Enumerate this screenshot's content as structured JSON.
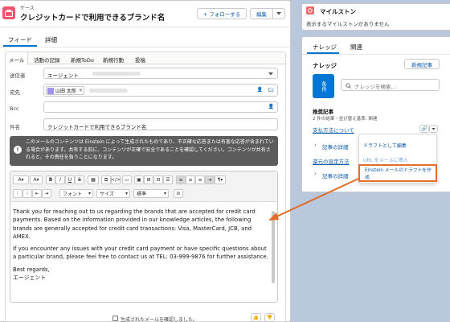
{
  "header": {
    "object_label": "ケース",
    "title": "クレジットカードで利用できるブランド名",
    "follow_label": "+ フォローする",
    "edit_label": "編集"
  },
  "tabs": {
    "feed": "フィード",
    "detail": "詳細"
  },
  "composer_tabs": [
    "メール",
    "活動の記録",
    "新規ToDo",
    "新規行動",
    "投稿"
  ],
  "email": {
    "from_label": "送信者",
    "from_value": "エージェント",
    "to_label": "宛先",
    "to_chip": "山田 太郎",
    "cc_label": "Cc",
    "bcc_label": "Bcc",
    "subject_label": "件名",
    "subject_value": "クレジットカードで利用できるブランド名",
    "notice": "このメールのコンテンツは Einstein によって生成されたものであり、不正確な応答または有害な応答が含まれている場合があります。共有する前に、コンテンツが正確で安全であることを確認してください。コンテンツが共有されると、その責任を負うことになります。",
    "font_select": "フォント",
    "size_select": "サイズ",
    "style_select": "標準",
    "body": [
      "Thank you for reaching out to us regarding the brands that are accepted for credit card payments. Based on the information provided in our knowledge articles, the following brands are generally accepted for credit card transactions: Visa, MasterCard, JCB, and AMEX.",
      "If you encounter any issues with your credit card payment or have specific questions about a particular brand, please feel free to contact us at TEL: 03-999-9876 for further assistance.",
      "Best regards,",
      "エージェント"
    ],
    "verify_label": "生成されたメールを確認しました。"
  },
  "milestone": {
    "title": "マイルストン",
    "empty_text": "表示するマイルストンがありません"
  },
  "knowledge": {
    "tab_knowledge": "ナレッジ",
    "tab_related": "関連",
    "section_title": "ナレッジ",
    "new_article": "新規記事",
    "filter_button": "条件",
    "search_placeholder": "ナレッジを検索...",
    "recommended_title": "推奨記事",
    "recommended_sub": "2 件の結果・並び替え基準: 関連",
    "article1_link": "支払方法について",
    "article1_detail": "記事の詳細",
    "article2_link": "還元の設定方法",
    "article2_detail": "記事の詳細",
    "menu_edit_draft": "ドラフトとして編集",
    "menu_insert_url": "URL をメールに挿入",
    "menu_einstein_draft": "Einstein メールのドラフトを作成"
  },
  "colors": {
    "brand_blue": "#0176d3",
    "highlight_orange": "#e36d2a",
    "case_pink": "#f2536d",
    "milestone_orange": "#e9696e",
    "notice_gray": "#5c5c5c"
  }
}
